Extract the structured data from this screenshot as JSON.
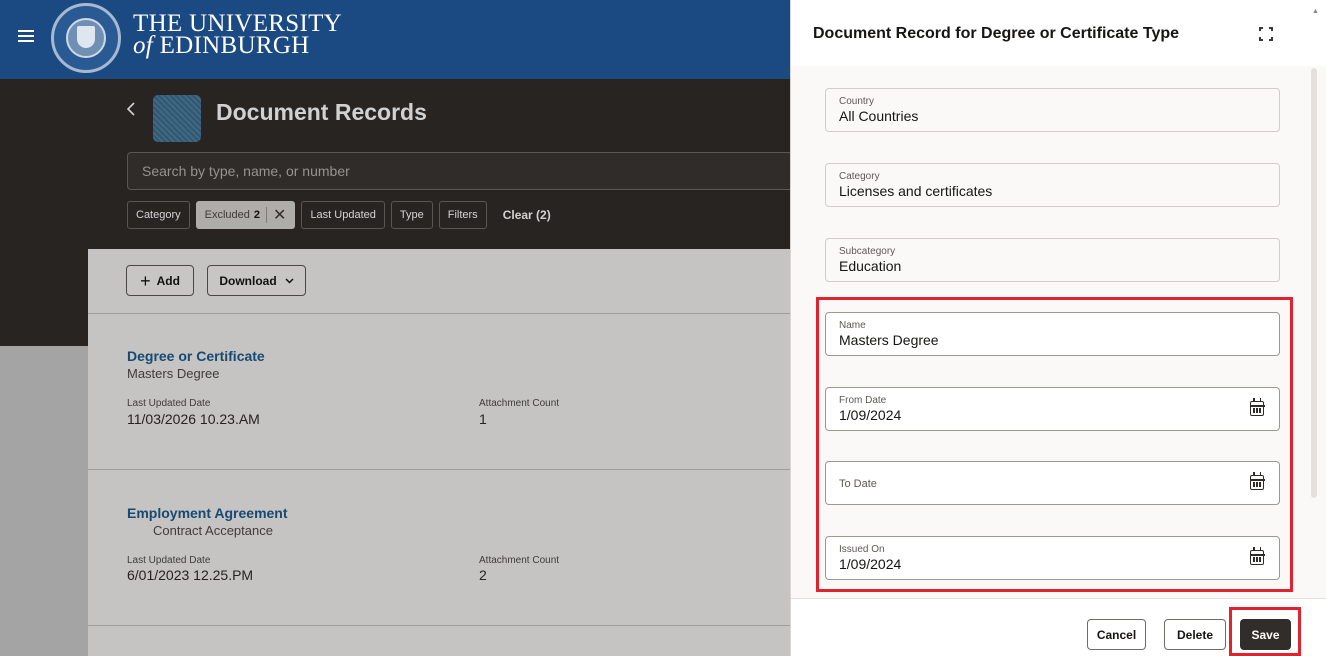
{
  "header": {
    "uni_line1": "THE UNIVERSITY",
    "uni_line2_prefix": "of",
    "uni_line2": "EDINBURGH"
  },
  "page": {
    "title": "Document Records",
    "search_placeholder": "Search by type, name, or number"
  },
  "filters": {
    "category": "Category",
    "excluded_label": "Excluded",
    "excluded_count": "2",
    "last_updated": "Last Updated",
    "type": "Type",
    "filters": "Filters",
    "clear": "Clear (2)"
  },
  "toolbar": {
    "add_label": "Add",
    "download_label": "Download"
  },
  "records": [
    {
      "title": "Degree or Certificate",
      "subtitle": "Masters Degree",
      "last_updated_label": "Last Updated Date",
      "last_updated_value": "11/03/2026 10.23.AM",
      "attachment_label": "Attachment Count",
      "attachment_value": "1"
    },
    {
      "title": "Employment Agreement",
      "subtitle": "Contract Acceptance",
      "last_updated_label": "Last Updated Date",
      "last_updated_value": "6/01/2023 12.25.PM",
      "attachment_label": "Attachment Count",
      "attachment_value": "2"
    }
  ],
  "drawer": {
    "title": "Document Record for Degree or Certificate Type",
    "fields": {
      "country": {
        "label": "Country",
        "value": "All Countries"
      },
      "category": {
        "label": "Category",
        "value": "Licenses and certificates"
      },
      "subcategory": {
        "label": "Subcategory",
        "value": "Education"
      },
      "name": {
        "label": "Name",
        "value": "Masters Degree"
      },
      "from_date": {
        "label": "From Date",
        "value": "1/09/2024"
      },
      "to_date": {
        "label": "To Date",
        "value": ""
      },
      "issued_on": {
        "label": "Issued On",
        "value": "1/09/2024"
      }
    },
    "buttons": {
      "cancel": "Cancel",
      "delete": "Delete",
      "save": "Save"
    }
  },
  "colors": {
    "header_blue": "#1b4a83",
    "dark_band": "#312d2a",
    "link_blue": "#1b5b8c",
    "highlight_red": "#e0242f"
  },
  "icons": {
    "menu": "hamburger-icon",
    "crest": "university-crest-logo",
    "back": "chevron-left-icon",
    "remove_filter": "close-icon",
    "add": "plus-icon",
    "download_menu": "chevron-down-icon",
    "expand": "expand-icon",
    "date": "calendar-icon"
  }
}
